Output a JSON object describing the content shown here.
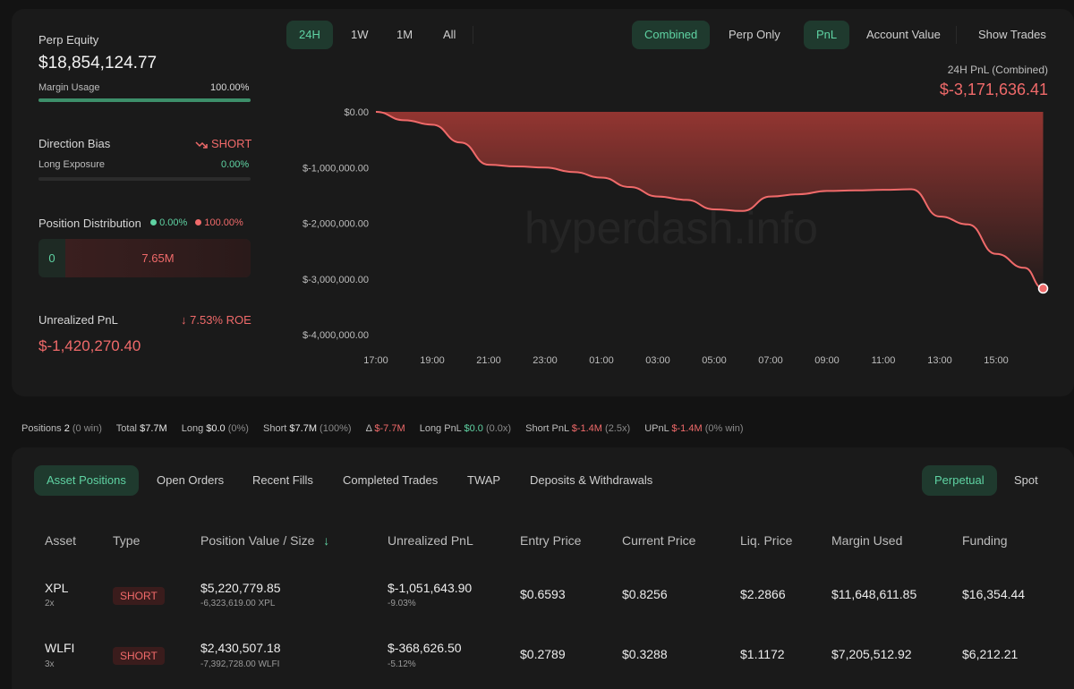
{
  "left": {
    "perp_equity_label": "Perp Equity",
    "perp_equity_value": "$18,854,124.77",
    "margin_usage_label": "Margin Usage",
    "margin_usage_value": "100.00%",
    "margin_usage_fraction": 1.0,
    "direction_bias_label": "Direction Bias",
    "direction_bias_value": "SHORT",
    "long_exposure_label": "Long Exposure",
    "long_exposure_value": "0.00%",
    "long_exposure_fraction": 0.0,
    "position_distribution_label": "Position Distribution",
    "dist_long_pct": "0.00%",
    "dist_short_pct": "100.00%",
    "dist_long_value": "0",
    "dist_short_value": "7.65M",
    "unrealized_pnl_label": "Unrealized PnL",
    "roe_value": "7.53% ROE",
    "unrealized_pnl_value": "$-1,420,270.40"
  },
  "ranges": [
    "24H",
    "1W",
    "1M",
    "All"
  ],
  "views": {
    "combined": "Combined",
    "perp_only": "Perp Only",
    "pnl": "PnL",
    "account_value": "Account Value",
    "show_trades": "Show Trades"
  },
  "chart_header": {
    "label": "24H PnL (Combined)",
    "value": "$-3,171,636.41"
  },
  "watermark": "hyperdash.info",
  "chart_data": {
    "type": "area",
    "x": [
      "17:00",
      "18:00",
      "19:00",
      "20:00",
      "21:00",
      "22:00",
      "23:00",
      "00:00",
      "01:00",
      "02:00",
      "03:00",
      "04:00",
      "05:00",
      "06:00",
      "07:00",
      "08:00",
      "09:00",
      "10:00",
      "11:00",
      "12:00",
      "13:00",
      "14:00",
      "15:00",
      "16:00",
      "16:40"
    ],
    "x_ticks": [
      "17:00",
      "19:00",
      "21:00",
      "23:00",
      "01:00",
      "03:00",
      "05:00",
      "07:00",
      "09:00",
      "11:00",
      "13:00",
      "15:00"
    ],
    "y_ticks": [
      "$0.00",
      "$-1,000,000.00",
      "$-2,000,000.00",
      "$-3,000,000.00",
      "$-4,000,000.00"
    ],
    "y_tick_values": [
      0,
      -1000000,
      -2000000,
      -3000000,
      -4000000
    ],
    "values": [
      0,
      -150000,
      -230000,
      -550000,
      -950000,
      -980000,
      -1000000,
      -1080000,
      -1180000,
      -1350000,
      -1520000,
      -1580000,
      -1750000,
      -1780000,
      -1520000,
      -1480000,
      -1420000,
      -1410000,
      -1400000,
      -1390000,
      -1880000,
      -2020000,
      -2550000,
      -2800000,
      -3171636
    ],
    "ylim": [
      -4000000,
      0
    ],
    "line_color": "#f06a6a",
    "fill_color": "#a83a35"
  },
  "summary": {
    "positions_label": "Positions",
    "positions_value": "2",
    "positions_note": "(0 win)",
    "total_label": "Total",
    "total_value": "$7.7M",
    "long_label": "Long",
    "long_value": "$0.0",
    "long_note": "(0%)",
    "short_label": "Short",
    "short_value": "$7.7M",
    "short_note": "(100%)",
    "delta_label": "Δ",
    "delta_value": "$-7.7M",
    "long_pnl_label": "Long PnL",
    "long_pnl_value": "$0.0",
    "long_pnl_note": "(0.0x)",
    "short_pnl_label": "Short PnL",
    "short_pnl_value": "$-1.4M",
    "short_pnl_note": "(2.5x)",
    "upnl_label": "UPnL",
    "upnl_value": "$-1.4M",
    "upnl_note": "(0% win)"
  },
  "tabs": [
    "Asset Positions",
    "Open Orders",
    "Recent Fills",
    "Completed Trades",
    "TWAP",
    "Deposits & Withdrawals"
  ],
  "market_tabs": [
    "Perpetual",
    "Spot"
  ],
  "table": {
    "headers": [
      "Asset",
      "Type",
      "Position Value / Size",
      "Unrealized PnL",
      "Entry Price",
      "Current Price",
      "Liq. Price",
      "Margin Used",
      "Funding"
    ],
    "rows": [
      {
        "asset": "XPL",
        "leverage": "2x",
        "type": "SHORT",
        "position_value": "$5,220,779.85",
        "size": "-6,323,619.00 XPL",
        "upnl": "$-1,051,643.90",
        "upnl_pct": "-9.03%",
        "entry": "$0.6593",
        "current": "$0.8256",
        "liq": "$2.2866",
        "margin": "$11,648,611.85",
        "funding": "$16,354.44"
      },
      {
        "asset": "WLFI",
        "leverage": "3x",
        "type": "SHORT",
        "position_value": "$2,430,507.18",
        "size": "-7,392,728.00 WLFI",
        "upnl": "$-368,626.50",
        "upnl_pct": "-5.12%",
        "entry": "$0.2789",
        "current": "$0.3288",
        "liq": "$1.1172",
        "margin": "$7,205,512.92",
        "funding": "$6,212.21"
      }
    ]
  }
}
